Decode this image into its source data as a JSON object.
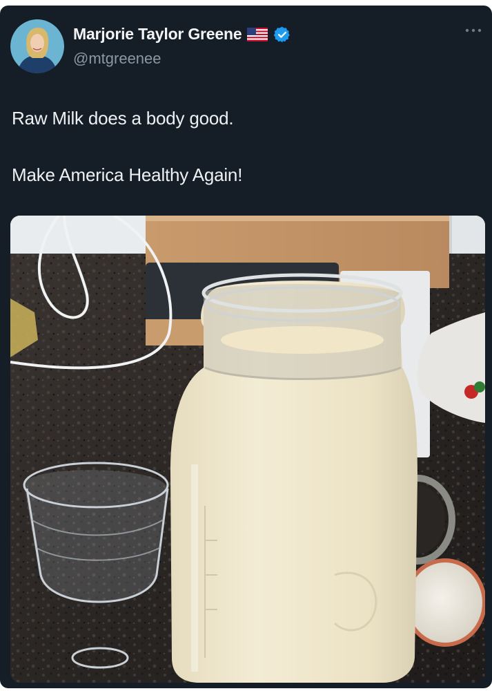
{
  "author": {
    "name": "Marjorie Taylor Greene",
    "handle": "@mtgreenee",
    "flag_icon": "us-flag-icon",
    "verified_icon": "verified-badge-icon"
  },
  "tweet": {
    "lines": [
      "Raw Milk does a body good.",
      "Make America Healthy Again!"
    ]
  },
  "media": {
    "description_icon": "photo-milk-jar"
  },
  "colors": {
    "card_bg": "#151d27",
    "name": "#f2f4f6",
    "handle": "#8b98a5",
    "verified": "#1d9bf0"
  }
}
